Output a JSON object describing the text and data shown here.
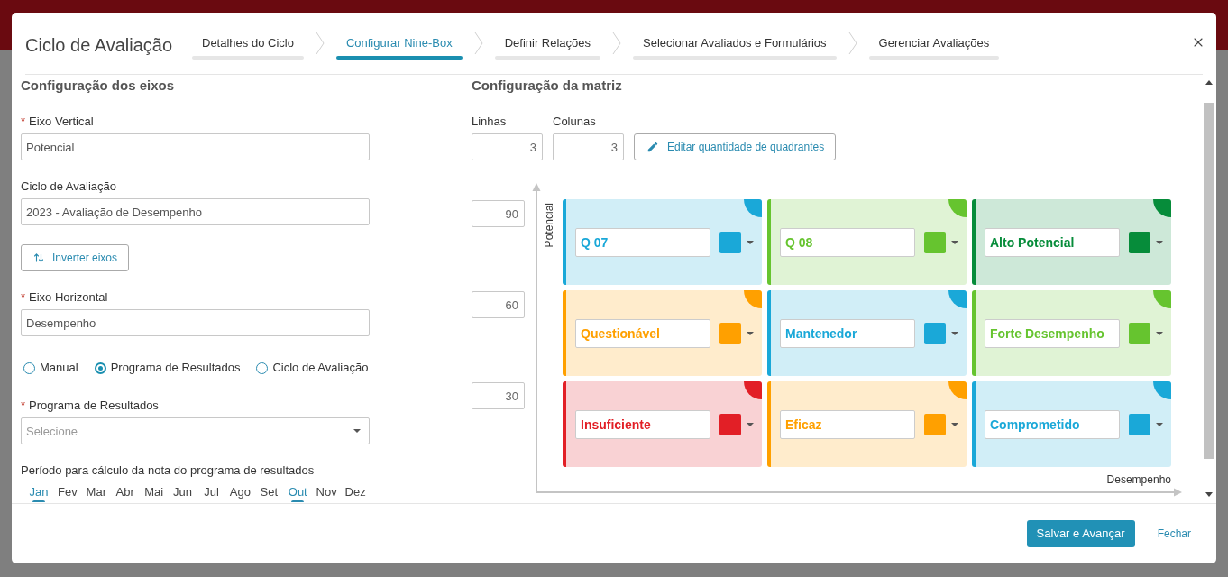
{
  "dialog": {
    "title": "Ciclo de Avaliação"
  },
  "steps": [
    {
      "label": "Detalhes do Ciclo",
      "selected": false
    },
    {
      "label": "Configurar Nine-Box",
      "selected": true
    },
    {
      "label": "Definir Relações",
      "selected": false
    },
    {
      "label": "Selecionar Avaliados e Formulários",
      "selected": false
    },
    {
      "label": "Gerenciar Avaliações",
      "selected": false
    }
  ],
  "axes_config": {
    "heading": "Configuração dos eixos",
    "vertical_axis": {
      "required_mark": "*",
      "label": "Eixo Vertical",
      "value": "Potencial"
    },
    "cycle": {
      "label": "Ciclo de Avaliação",
      "value": "2023 - Avaliação de Desempenho"
    },
    "invert_button": "Inverter eixos",
    "horizontal_axis": {
      "required_mark": "*",
      "label": "Eixo Horizontal",
      "value": "Desempenho"
    },
    "source_options": [
      {
        "label": "Manual",
        "selected": false
      },
      {
        "label": "Programa de Resultados",
        "selected": true
      },
      {
        "label": "Ciclo de Avaliação",
        "selected": false
      }
    ],
    "results_program": {
      "required_mark": "*",
      "label": "Programa de Resultados",
      "placeholder": "Selecione"
    },
    "period": {
      "label": "Período para cálculo da nota do programa de resultados",
      "months": [
        {
          "label": "Jan",
          "selected": true
        },
        {
          "label": "Fev",
          "selected": false
        },
        {
          "label": "Mar",
          "selected": false
        },
        {
          "label": "Abr",
          "selected": false
        },
        {
          "label": "Mai",
          "selected": false
        },
        {
          "label": "Jun",
          "selected": false
        },
        {
          "label": "Jul",
          "selected": false
        },
        {
          "label": "Ago",
          "selected": false
        },
        {
          "label": "Set",
          "selected": false
        },
        {
          "label": "Out",
          "selected": true
        },
        {
          "label": "Nov",
          "selected": false
        },
        {
          "label": "Dez",
          "selected": false
        }
      ]
    }
  },
  "matrix_config": {
    "heading": "Configuração da matriz",
    "rows": {
      "label": "Linhas",
      "value": "3"
    },
    "columns": {
      "label": "Colunas",
      "value": "3"
    },
    "edit_button": "Editar quantidade de quadrantes",
    "row_limits": [
      "90",
      "60",
      "30"
    ],
    "y_axis_label": "Potencial",
    "x_axis_label": "Desempenho",
    "quadrants": [
      [
        {
          "name": "Q 07",
          "color": "#1aa8d8"
        },
        {
          "name": "Q 08",
          "color": "#66c42f"
        },
        {
          "name": "Alto Potencial",
          "color": "#068c3a"
        }
      ],
      [
        {
          "name": "Questionável",
          "color": "#ffa000"
        },
        {
          "name": "Mantenedor",
          "color": "#1aa8d8"
        },
        {
          "name": "Forte Desempenho",
          "color": "#66c42f"
        }
      ],
      [
        {
          "name": "Insuficiente",
          "color": "#e21f26"
        },
        {
          "name": "Eficaz",
          "color": "#ffa000"
        },
        {
          "name": "Comprometido",
          "color": "#1aa8d8"
        }
      ]
    ]
  },
  "footer": {
    "primary_button": "Salvar e Avançar",
    "close_link": "Fechar"
  }
}
